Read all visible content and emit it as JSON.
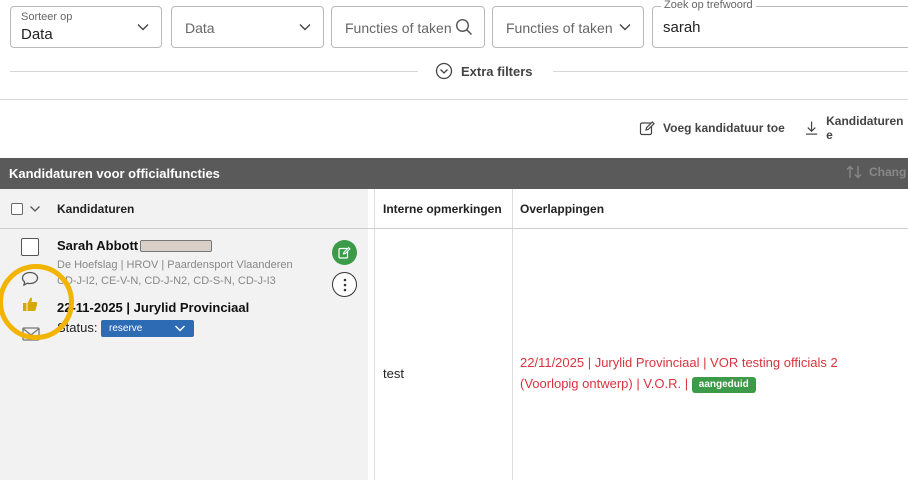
{
  "filters": {
    "sort": {
      "label": "Sorteer op",
      "value": "Data"
    },
    "data_select": {
      "value": "Data"
    },
    "functies_search": {
      "placeholder": "Functies of taken"
    },
    "functies_select": {
      "value": "Functies of taken"
    },
    "zoek": {
      "label": "Zoek op trefwoord",
      "value": "sarah"
    },
    "extra_filters": "Extra filters"
  },
  "actions": {
    "add_candidacy": "Voeg kandidatuur toe",
    "export": "Kandidaturen e"
  },
  "section": {
    "title": "Kandidaturen voor officialfuncties",
    "change": "Chang"
  },
  "table": {
    "headers": {
      "candidacies": "Kandidaturen",
      "internal_remarks": "Interne opmerkingen",
      "overlaps": "Overlappingen"
    },
    "rows": [
      {
        "name": "Sarah Abbott",
        "meta_line1": "De Hoefslag | HROV | Paardensport Vlaanderen",
        "meta_line2": "CD-J-I2, CE-V-N, CD-J-N2, CD-S-N, CD-J-I3",
        "function": "22-11-2025 | Jurylid Provinciaal",
        "status_label": "Status:",
        "status_value": "reserve",
        "remark": "test",
        "overlap_text": "22/11/2025 | Jurylid Provinciaal | VOR testing officials 2 (Voorlopig ontwerp) | V.O.R. |",
        "overlap_badge": "aangeduid"
      }
    ]
  },
  "colors": {
    "band": "#5a5a5a",
    "status_blue": "#2d6bb5",
    "green": "#3c9b48",
    "overlap_red": "#d8343e",
    "highlight": "#f2b400"
  },
  "icons": [
    "chevron-down-icon",
    "search-icon",
    "circle-chevron-down-icon",
    "edit-icon",
    "download-icon",
    "change-icon",
    "comment-icon",
    "thumbs-up-icon",
    "mail-icon",
    "more-vertical-icon"
  ]
}
